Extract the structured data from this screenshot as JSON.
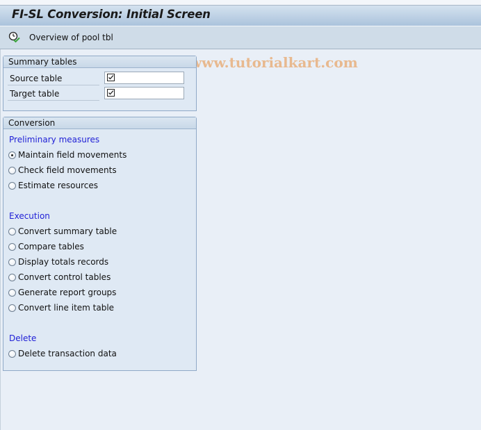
{
  "window": {
    "title": "FI-SL Conversion: Initial Screen"
  },
  "toolbar": {
    "buttons": [
      {
        "icon": "clock-check-icon",
        "label": "Overview of pool tbl"
      }
    ]
  },
  "watermark": "© www.tutorialkart.com",
  "summary_tables": {
    "title": "Summary tables",
    "fields": [
      {
        "label": "Source table",
        "value": "",
        "checked": true
      },
      {
        "label": "Target table",
        "value": "",
        "checked": true
      }
    ]
  },
  "conversion": {
    "title": "Conversion",
    "sections": [
      {
        "title": "Preliminary measures",
        "options": [
          {
            "label": "Maintain field movements",
            "selected": true
          },
          {
            "label": "Check field movements",
            "selected": false
          },
          {
            "label": "Estimate resources",
            "selected": false
          }
        ]
      },
      {
        "title": "Execution",
        "options": [
          {
            "label": "Convert summary table",
            "selected": false
          },
          {
            "label": "Compare tables",
            "selected": false
          },
          {
            "label": "Display totals records",
            "selected": false
          },
          {
            "label": "Convert control tables",
            "selected": false
          },
          {
            "label": "Generate report groups",
            "selected": false
          },
          {
            "label": "Convert line item table",
            "selected": false
          }
        ]
      },
      {
        "title": "Delete",
        "options": [
          {
            "label": "Delete transaction data",
            "selected": false
          }
        ]
      }
    ]
  }
}
